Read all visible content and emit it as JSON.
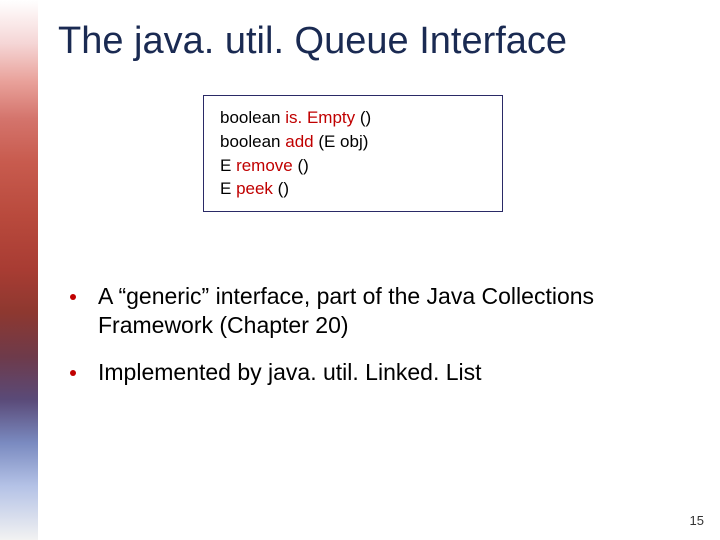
{
  "title": "The java. util. Queue Interface",
  "methods": [
    {
      "ret": "boolean ",
      "name": "is. Empty",
      "params": " ()"
    },
    {
      "ret": "boolean ",
      "name": "add",
      "params": " (E obj)"
    },
    {
      "ret": "E ",
      "name": "remove",
      "params": " ()"
    },
    {
      "ret": "E ",
      "name": "peek",
      "params": " ()"
    }
  ],
  "bullets": [
    "A “generic” interface, part of the Java Collections Framework (Chapter 20)",
    "Implemented by java. util. Linked. List"
  ],
  "pageNumber": "15"
}
